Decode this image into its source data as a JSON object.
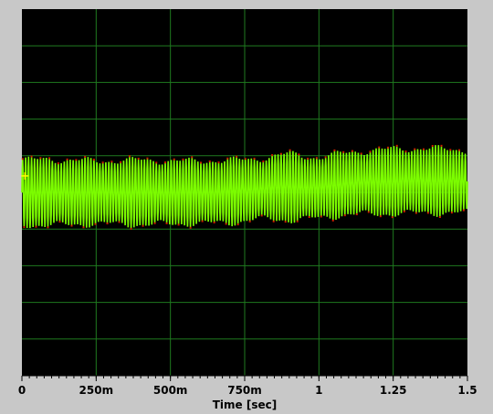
{
  "chart_data": {
    "type": "line",
    "title": "",
    "xlabel": "Time [sec]",
    "ylabel": "",
    "xlim": [
      0,
      1.5
    ],
    "grid": true,
    "x_ticks": [
      {
        "value": 0,
        "label": "0"
      },
      {
        "value": 0.25,
        "label": "250m"
      },
      {
        "value": 0.5,
        "label": "500m"
      },
      {
        "value": 0.75,
        "label": "750m"
      },
      {
        "value": 1.0,
        "label": "1"
      },
      {
        "value": 1.25,
        "label": "1.25"
      },
      {
        "value": 1.5,
        "label": "1.5"
      }
    ],
    "series": [
      {
        "color": "#7cfc00",
        "carrier_cycles": 150,
        "envelope_center": {
          "x": [
            0,
            0.1,
            0.25,
            0.4,
            0.55,
            0.7,
            0.8,
            0.9,
            1.0,
            1.1,
            1.25,
            1.35,
            1.5
          ],
          "y": [
            0.0,
            0.0,
            0.0,
            0.0,
            0.0,
            0.02,
            0.1,
            0.15,
            0.12,
            0.25,
            0.3,
            0.32,
            0.3
          ]
        },
        "envelope_amplitude": {
          "x": [
            0,
            0.1,
            0.25,
            0.4,
            0.55,
            0.7,
            0.8,
            0.9,
            1.0,
            1.1,
            1.25,
            1.35,
            1.5
          ],
          "y": [
            0.88,
            0.9,
            0.85,
            0.88,
            0.85,
            0.85,
            0.82,
            0.9,
            0.82,
            0.85,
            0.88,
            0.88,
            0.85
          ]
        }
      },
      {
        "color": "#cc2200",
        "role": "peak markers"
      }
    ],
    "cursor_marker": {
      "x": 0.01,
      "y": 0.45,
      "color": "#ffff00"
    },
    "colors": {
      "plot_background": "#000000",
      "grid": "#1f7a1f",
      "frame": "#c8c8c8"
    }
  }
}
